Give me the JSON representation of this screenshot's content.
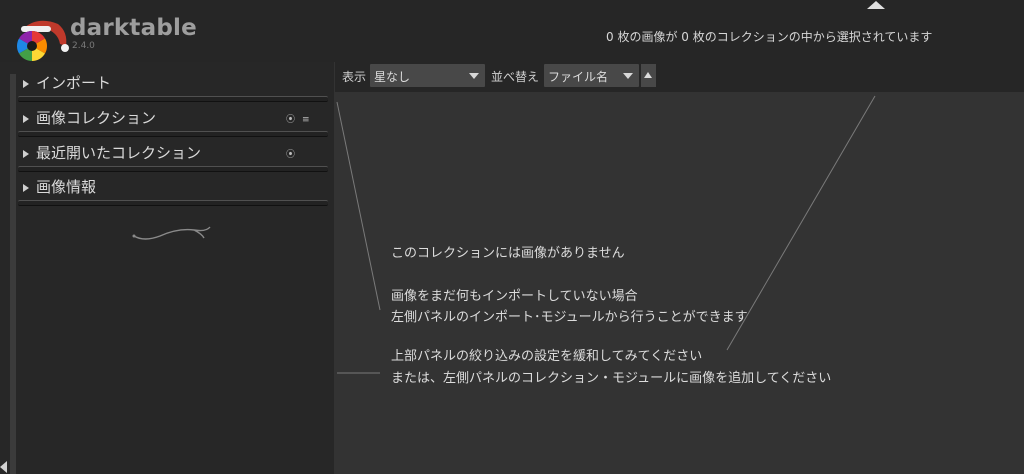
{
  "header": {
    "app_name": "darktable",
    "app_version": "2.4.0",
    "status_line": "0 枚の画像が 0 枚のコレクションの中から選択されています"
  },
  "left_panel": {
    "modules": [
      {
        "label": "インポート"
      },
      {
        "label": "画像コレクション",
        "icons": [
          "reset-icon",
          "presets-icon"
        ]
      },
      {
        "label": "最近開いたコレクション",
        "icons": [
          "reset-icon"
        ]
      },
      {
        "label": "画像情報"
      }
    ]
  },
  "toolbar": {
    "view_label": "表示",
    "rating_filter": "星なし",
    "sort_label": "並べ替え",
    "sort_field": "ファイル名",
    "sort_direction": "ascending"
  },
  "empty_collection": {
    "line1": "このコレクションには画像がありません",
    "line2": "画像をまだ何もインポートしていない場合",
    "line3": "左側パネルのインポート･モジュールから行うことができます",
    "line4": "上部パネルの絞り込みの設定を緩和してみてください",
    "line5": "または、左側パネルのコレクション・モジュールに画像を追加してください"
  },
  "colors": {
    "background": "#333333",
    "panel": "#272727",
    "header": "#262626",
    "text": "#dcdcdc"
  }
}
